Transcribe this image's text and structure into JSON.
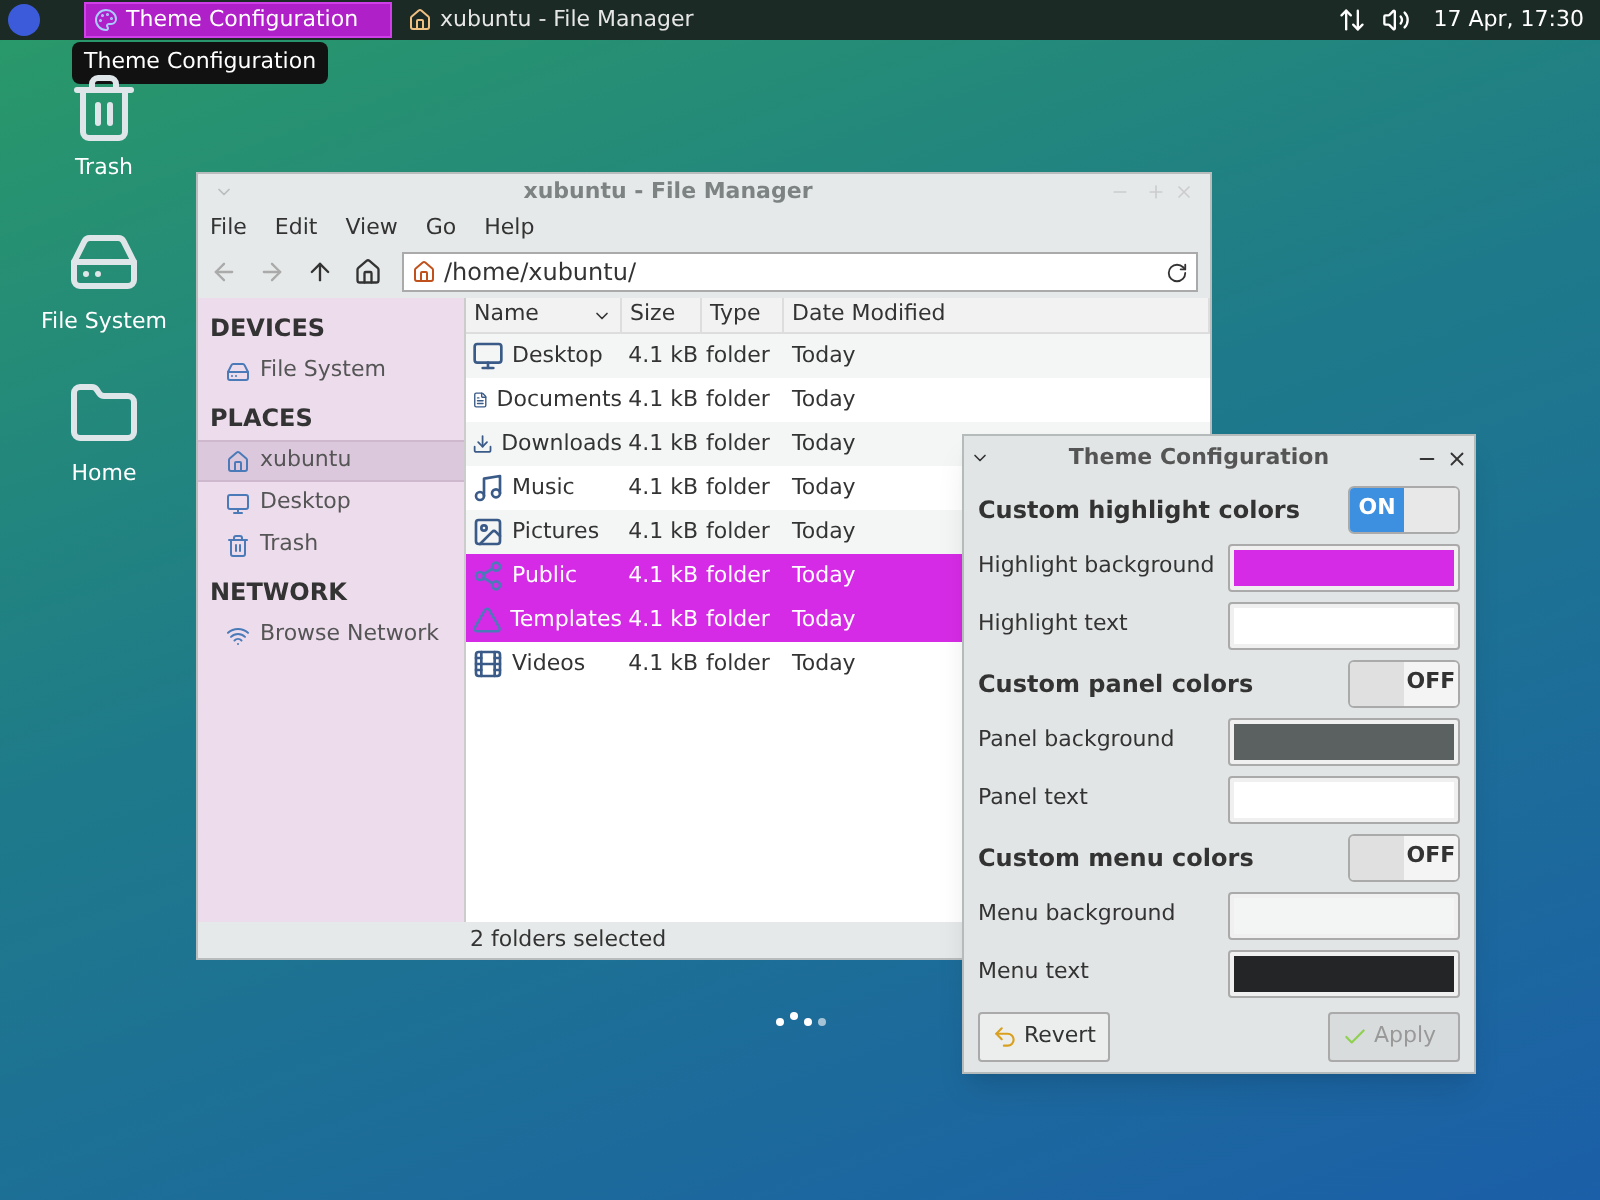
{
  "top_panel": {
    "tasks": [
      {
        "label": "Theme Configuration",
        "selected": true,
        "kind": "palette"
      },
      {
        "label": "xubuntu - File Manager",
        "selected": false,
        "kind": "home"
      }
    ],
    "tooltip": "Theme Configuration",
    "clock": "17 Apr, 17:30"
  },
  "desktop_icons": [
    {
      "label": "Trash",
      "kind": "trash"
    },
    {
      "label": "File System",
      "kind": "drive"
    },
    {
      "label": "Home",
      "kind": "folder"
    }
  ],
  "file_manager": {
    "title": "xubuntu - File Manager",
    "menu": [
      "File",
      "Edit",
      "View",
      "Go",
      "Help"
    ],
    "location": "/home/xubuntu/",
    "sidebar": [
      {
        "heading": "DEVICES",
        "items": [
          {
            "label": "File System",
            "kind": "drive",
            "selected": false
          }
        ]
      },
      {
        "heading": "PLACES",
        "items": [
          {
            "label": "xubuntu",
            "kind": "home",
            "selected": true
          },
          {
            "label": "Desktop",
            "kind": "monitor",
            "selected": false
          },
          {
            "label": "Trash",
            "kind": "trash",
            "selected": false
          }
        ]
      },
      {
        "heading": "NETWORK",
        "items": [
          {
            "label": "Browse Network",
            "kind": "wifi",
            "selected": false
          }
        ]
      }
    ],
    "columns": [
      "Name",
      "Size",
      "Type",
      "Date Modified"
    ],
    "rows": [
      {
        "name": "Desktop",
        "size": "4.1 kB",
        "type": "folder",
        "date": "Today",
        "kind": "monitor",
        "selected": false
      },
      {
        "name": "Documents",
        "size": "4.1 kB",
        "type": "folder",
        "date": "Today",
        "kind": "document",
        "selected": false
      },
      {
        "name": "Downloads",
        "size": "4.1 kB",
        "type": "folder",
        "date": "Today",
        "kind": "download",
        "selected": false
      },
      {
        "name": "Music",
        "size": "4.1 kB",
        "type": "folder",
        "date": "Today",
        "kind": "music",
        "selected": false
      },
      {
        "name": "Pictures",
        "size": "4.1 kB",
        "type": "folder",
        "date": "Today",
        "kind": "image",
        "selected": false
      },
      {
        "name": "Public",
        "size": "4.1 kB",
        "type": "folder",
        "date": "Today",
        "kind": "share",
        "selected": true
      },
      {
        "name": "Templates",
        "size": "4.1 kB",
        "type": "folder",
        "date": "Today",
        "kind": "ruler",
        "selected": true
      },
      {
        "name": "Videos",
        "size": "4.1 kB",
        "type": "folder",
        "date": "Today",
        "kind": "film",
        "selected": false
      }
    ],
    "status": "2 folders selected"
  },
  "theme_dialog": {
    "title": "Theme Configuration",
    "rows": [
      {
        "kind": "toggle",
        "label": "Custom highlight colors",
        "on": true,
        "text": "ON"
      },
      {
        "kind": "color",
        "label": "Highlight background",
        "color": "#d62be6"
      },
      {
        "kind": "color",
        "label": "Highlight text",
        "color": "#ffffff"
      },
      {
        "kind": "toggle",
        "label": "Custom panel colors",
        "on": false,
        "text": "OFF"
      },
      {
        "kind": "color",
        "label": "Panel background",
        "color": "#5b6061"
      },
      {
        "kind": "color",
        "label": "Panel text",
        "color": "#ffffff"
      },
      {
        "kind": "toggle",
        "label": "Custom menu colors",
        "on": false,
        "text": "OFF"
      },
      {
        "kind": "color",
        "label": "Menu background",
        "color": "#f3f4f4"
      },
      {
        "kind": "color",
        "label": "Menu text",
        "color": "#242526"
      }
    ],
    "buttons": [
      {
        "label": "Revert",
        "kind": "revert",
        "disabled": false
      },
      {
        "label": "Apply",
        "kind": "check",
        "disabled": true
      }
    ]
  }
}
